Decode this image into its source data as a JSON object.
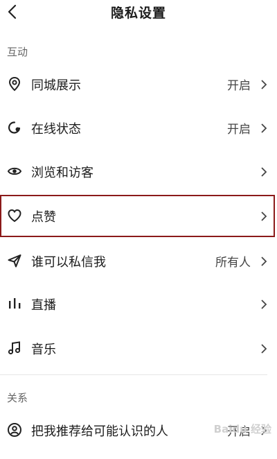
{
  "header": {
    "title": "隐私设置"
  },
  "sections": {
    "interaction": "互动",
    "relationship": "关系"
  },
  "rows": [
    {
      "label": "同城展示",
      "value": "开启",
      "icon": "location-pin-icon"
    },
    {
      "label": "在线状态",
      "value": "开启",
      "icon": "online-status-icon"
    },
    {
      "label": "浏览和访客",
      "value": "",
      "icon": "eye-icon"
    },
    {
      "label": "点赞",
      "value": "",
      "icon": "heart-icon"
    },
    {
      "label": "谁可以私信我",
      "value": "所有人",
      "icon": "send-icon"
    },
    {
      "label": "直播",
      "value": "",
      "icon": "live-bars-icon"
    },
    {
      "label": "音乐",
      "value": "",
      "icon": "music-note-icon"
    },
    {
      "label": "把我推荐给可能认识的人",
      "value": "开启",
      "icon": "user-icon"
    }
  ],
  "watermark": "Baidu 经验",
  "colors": {
    "highlight": "#8b1a1a"
  }
}
